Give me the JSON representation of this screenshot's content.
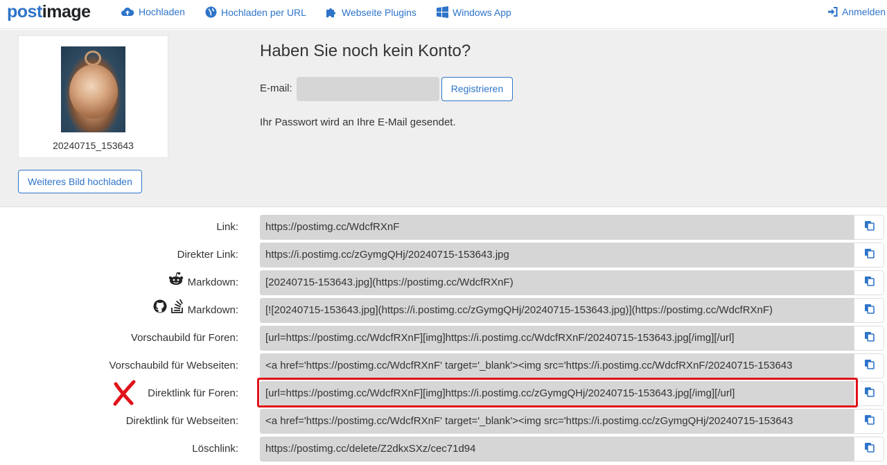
{
  "navbar": {
    "logo_post": "post",
    "logo_image": "image",
    "items": [
      {
        "label": "Hochladen",
        "icon": "cloud-upload-icon"
      },
      {
        "label": "Hochladen per URL",
        "icon": "globe-icon"
      },
      {
        "label": "Webseite Plugins",
        "icon": "puzzle-icon"
      },
      {
        "label": "Windows App",
        "icon": "windows-icon"
      },
      {
        "label": "Anmelden",
        "icon": "sign-in-icon"
      }
    ]
  },
  "upload": {
    "filename": "20240715_153643",
    "more_button": "Weiteres Bild hochladen"
  },
  "register": {
    "title": "Haben Sie noch kein Konto?",
    "email_label": "E-mail:",
    "email_value": "",
    "button": "Registrieren",
    "note": "Ihr Passwort wird an Ihre E-Mail gesendet."
  },
  "links": [
    {
      "label": "Link:",
      "value": "https://postimg.cc/WdcfRXnF"
    },
    {
      "label": "Direkter Link:",
      "value": "https://i.postimg.cc/zGymgQHj/20240715-153643.jpg"
    },
    {
      "label": "Markdown:",
      "icon": "reddit-icon",
      "value": "[20240715-153643.jpg](https://postimg.cc/WdcfRXnF)"
    },
    {
      "label": "Markdown:",
      "icon": "github-stackoverflow-icon",
      "value": "[![20240715-153643.jpg](https://i.postimg.cc/zGymgQHj/20240715-153643.jpg)](https://postimg.cc/WdcfRXnF)"
    },
    {
      "label": "Vorschaubild für Foren:",
      "value": "[url=https://postimg.cc/WdcfRXnF][img]https://i.postimg.cc/WdcfRXnF/20240715-153643.jpg[/img][/url]"
    },
    {
      "label": "Vorschaubild für Webseiten:",
      "value": "<a href='https://postimg.cc/WdcfRXnF' target='_blank'><img src='https://i.postimg.cc/WdcfRXnF/20240715-153643"
    },
    {
      "label": "Direktlink für Foren:",
      "value": "[url=https://postimg.cc/WdcfRXnF][img]https://i.postimg.cc/zGymgQHj/20240715-153643.jpg[/img][/url]"
    },
    {
      "label": "Direktlink für Webseiten:",
      "value": "<a href='https://postimg.cc/WdcfRXnF' target='_blank'><img src='https://i.postimg.cc/zGymgQHj/20240715-153643"
    },
    {
      "label": "Löschlink:",
      "value": "https://postimg.cc/delete/Z2dkxSXz/cec71d94"
    }
  ],
  "colors": {
    "accent": "#2e74c9",
    "field_bg": "#d6d6d6",
    "panel_bg": "#efefef",
    "highlight": "#e0121a"
  }
}
